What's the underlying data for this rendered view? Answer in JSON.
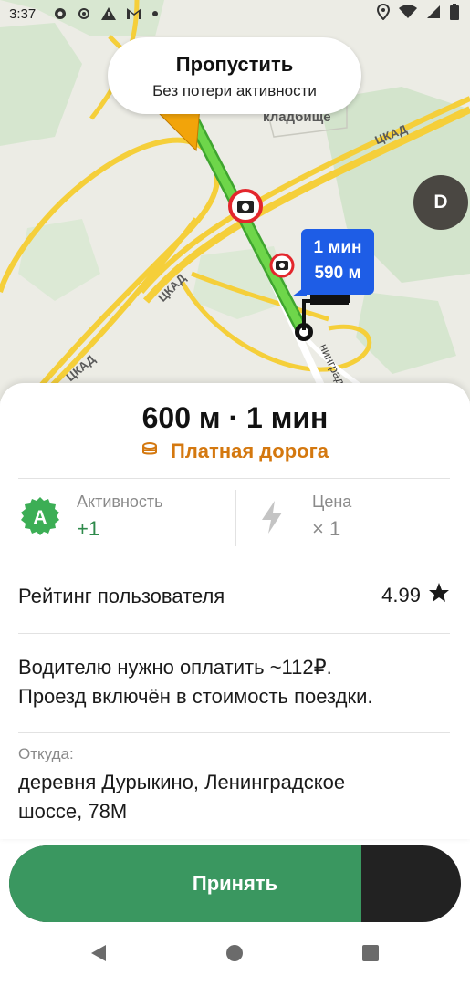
{
  "status_bar": {
    "time": "3:37",
    "icons": [
      "gear-icon",
      "location-target-icon",
      "warning-icon",
      "gmail-icon",
      "dot-icon",
      "location-pin-icon",
      "wifi-icon",
      "signal-icon",
      "battery-icon"
    ]
  },
  "map": {
    "cemetery_label": "кладбище",
    "road_label_1": "ЦКАД",
    "road_label_2": "ЦКАД",
    "road_label_3": "ЦКАД",
    "street_label": "нинград"
  },
  "skip_button": {
    "title": "Пропустить",
    "subtitle": "Без потери активности"
  },
  "avatar": {
    "initial": "D",
    "color": "#4a4742"
  },
  "route_bubble": {
    "time": "1 мин",
    "distance": "590 м",
    "color": "#1e5de6"
  },
  "trip": {
    "distance_time": "600 м · 1 мин",
    "toll_label": "Платная дорога",
    "toll_color": "#d4780f"
  },
  "activity": {
    "badge": "A",
    "label": "Активность",
    "value": "+1",
    "color": "#2e8a4b"
  },
  "price": {
    "label": "Цена",
    "value": "× 1"
  },
  "rating": {
    "label": "Рейтинг пользователя",
    "value": "4.99"
  },
  "note": {
    "line1": "Водителю нужно оплатить ~112₽.",
    "line2": "Проезд включён в стоимость поездки."
  },
  "origin": {
    "label": "Откуда:",
    "line1": "деревня Дурыкино, Ленинградское",
    "line2": "шоссе, 78М"
  },
  "accept": {
    "label": "Принять",
    "countdown_fraction": 0.78,
    "fill_color": "#3a9760"
  },
  "navbar": {
    "icons": [
      "back-icon",
      "home-icon",
      "recents-icon"
    ]
  }
}
